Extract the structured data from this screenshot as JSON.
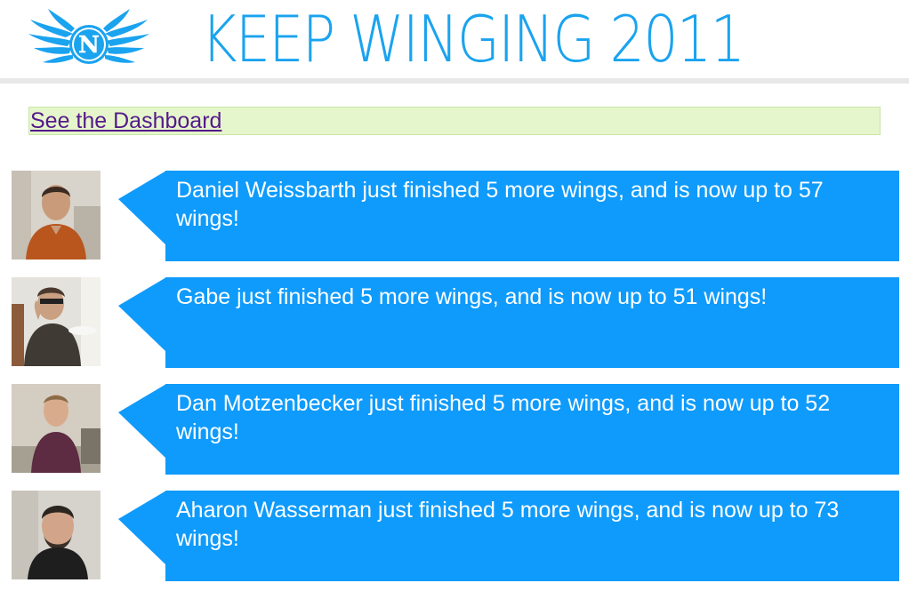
{
  "header": {
    "title": "KEEP WINGING 2011",
    "logo_letter": "N",
    "brand_color": "#1aa3ef"
  },
  "dashboard": {
    "link_label": "See the Dashboard"
  },
  "feed": {
    "bubble_color": "#0f9bfb",
    "items": [
      {
        "message": "Daniel Weissbarth just finished 5 more wings, and is now up to 57 wings!"
      },
      {
        "message": "Gabe just finished 5 more wings, and is now up to 51 wings!"
      },
      {
        "message": "Dan Motzenbecker just finished 5 more wings, and is now up to 52 wings!"
      },
      {
        "message": "Aharon Wasserman just finished 5 more wings, and is now up to 73 wings!"
      }
    ]
  }
}
